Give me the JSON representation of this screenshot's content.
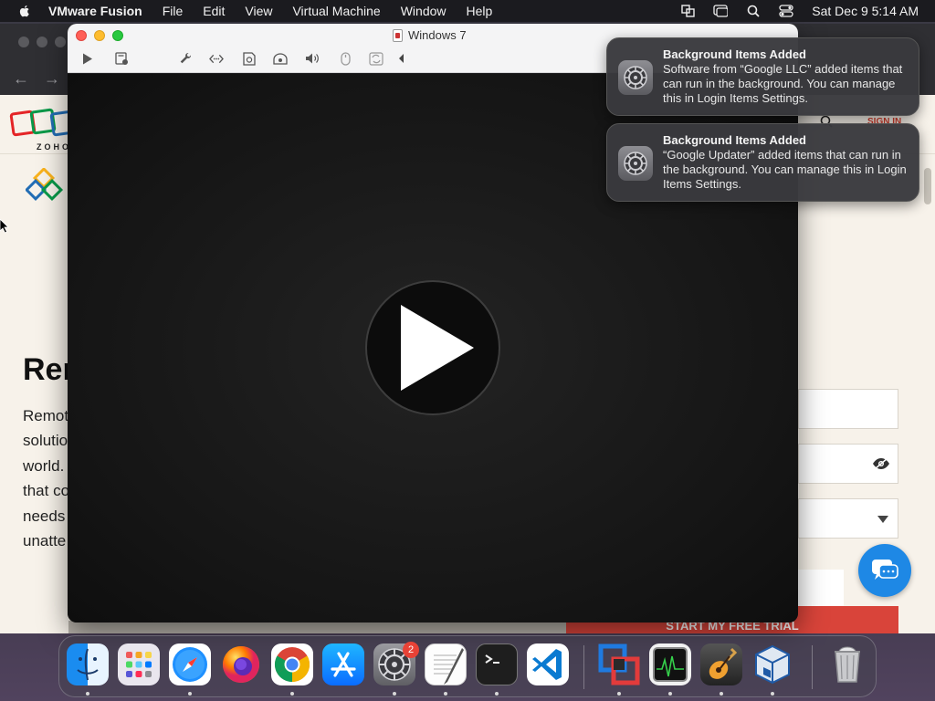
{
  "menubar": {
    "app_name": "VMware Fusion",
    "items": [
      "File",
      "Edit",
      "View",
      "Virtual Machine",
      "Window",
      "Help"
    ],
    "clock": "Sat Dec 9  5:14 AM",
    "status_icons": [
      "vmware-status-icon",
      "screen-mirroring-icon",
      "spotlight-search-icon",
      "control-center-icon"
    ]
  },
  "browser": {
    "page": {
      "heading": "Rer",
      "paragraph_lines": [
        "Remot",
        "solutio",
        "world.",
        "that co",
        "needs",
        "unatte"
      ],
      "sign_in": "SIGN IN",
      "trial_button": "START MY FREE TRIAL",
      "logo_text": "ZOHO",
      "brand_colors": [
        "#e42527",
        "#089949",
        "#226db4",
        "#f9b21d"
      ]
    }
  },
  "vm_window": {
    "title": "Windows 7",
    "toolbar_icons": [
      "play-icon",
      "snapshot-icon",
      "settings-wrench-icon",
      "network-icon",
      "disk-icon",
      "camera-icon",
      "sound-icon",
      "usb-icon",
      "sync-icon",
      "toolbar-collapse-icon"
    ],
    "screen_state": "play-icon"
  },
  "notifications": [
    {
      "title": "Background Items Added",
      "body": "Software from “Google LLC” added items that can run in the background. You can manage this in Login Items Settings."
    },
    {
      "title": "Background Items Added",
      "body": "“Google Updater” added items that can run in the background. You can manage this in Login Items Settings."
    }
  ],
  "dock": {
    "apps": [
      "Finder",
      "Launchpad",
      "Safari",
      "Firefox",
      "Chrome",
      "App Store",
      "System Settings",
      "TextEdit",
      "Terminal",
      "Visual Studio Code",
      "VMware Fusion",
      "Activity Monitor",
      "GarageBand",
      "VirtualBox",
      "Trash"
    ],
    "system_settings_badge": "2"
  }
}
